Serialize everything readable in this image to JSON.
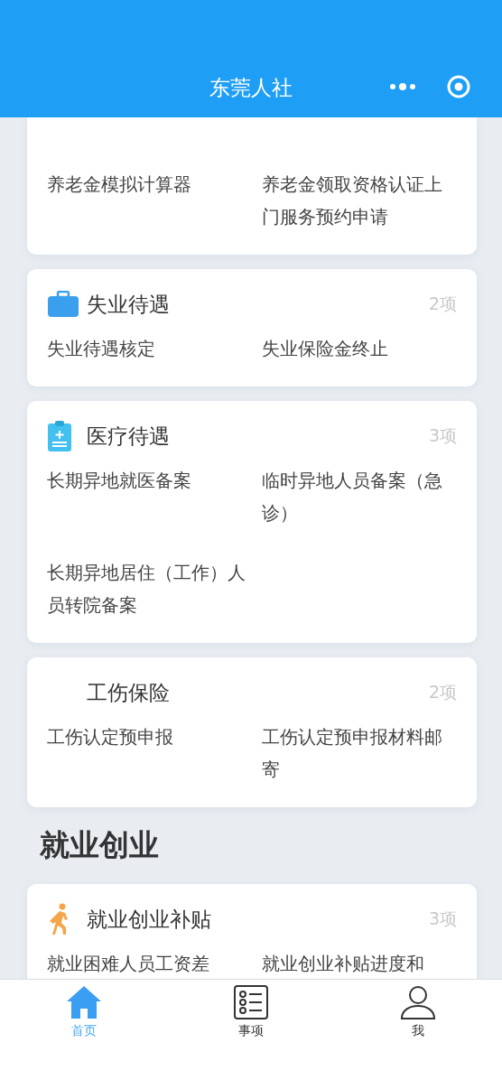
{
  "header": {
    "title": "东莞人社"
  },
  "cards": [
    {
      "items": [
        "养老金模拟计算器",
        "养老金领取资格认证上门服务预约申请"
      ]
    },
    {
      "title": "失业待遇",
      "count": "2项",
      "items": [
        "失业待遇核定",
        "失业保险金终止"
      ]
    },
    {
      "title": "医疗待遇",
      "count": "3项",
      "items": [
        "长期异地就医备案",
        "临时异地人员备案（急诊）",
        "长期异地居住（工作）人员转院备案"
      ]
    },
    {
      "title": "工伤保险",
      "count": "2项",
      "items": [
        "工伤认定预申报",
        "工伤认定预申报材料邮寄"
      ]
    }
  ],
  "section": {
    "title": "就业创业",
    "cards": [
      {
        "title": "就业创业补贴",
        "count": "3项",
        "items": [
          "就业困难人员工资差",
          "就业创业补贴进度和"
        ]
      }
    ]
  },
  "tabs": [
    {
      "label": "首页",
      "selected": true
    },
    {
      "label": "事项",
      "selected": false
    },
    {
      "label": "我",
      "selected": false
    }
  ]
}
